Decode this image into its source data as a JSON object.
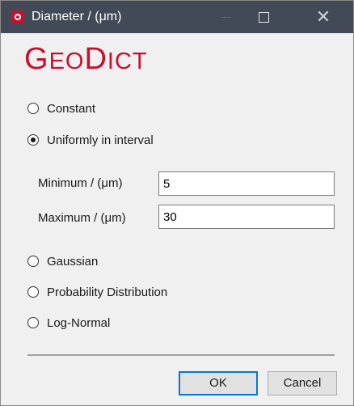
{
  "window": {
    "title": "Diameter / (μm)",
    "minimize_label": "",
    "maximize_label": "",
    "close_label": "✕"
  },
  "logo": {
    "g": "G",
    "eo": "EO",
    "d": "D",
    "ict": "ICT"
  },
  "options": {
    "constant": "Constant",
    "uniform": "Uniformly in interval",
    "gaussian": "Gaussian",
    "probability": "Probability Distribution",
    "lognormal": "Log-Normal",
    "selected": "uniform"
  },
  "interval": {
    "minimum_label": "Minimum / (μm)",
    "minimum_value": "5",
    "maximum_label": "Maximum / (μm)",
    "maximum_value": "30"
  },
  "buttons": {
    "ok": "OK",
    "cancel": "Cancel"
  },
  "colors": {
    "brand": "#c8102e",
    "titlebar": "#434a57",
    "focus": "#0078d7"
  }
}
